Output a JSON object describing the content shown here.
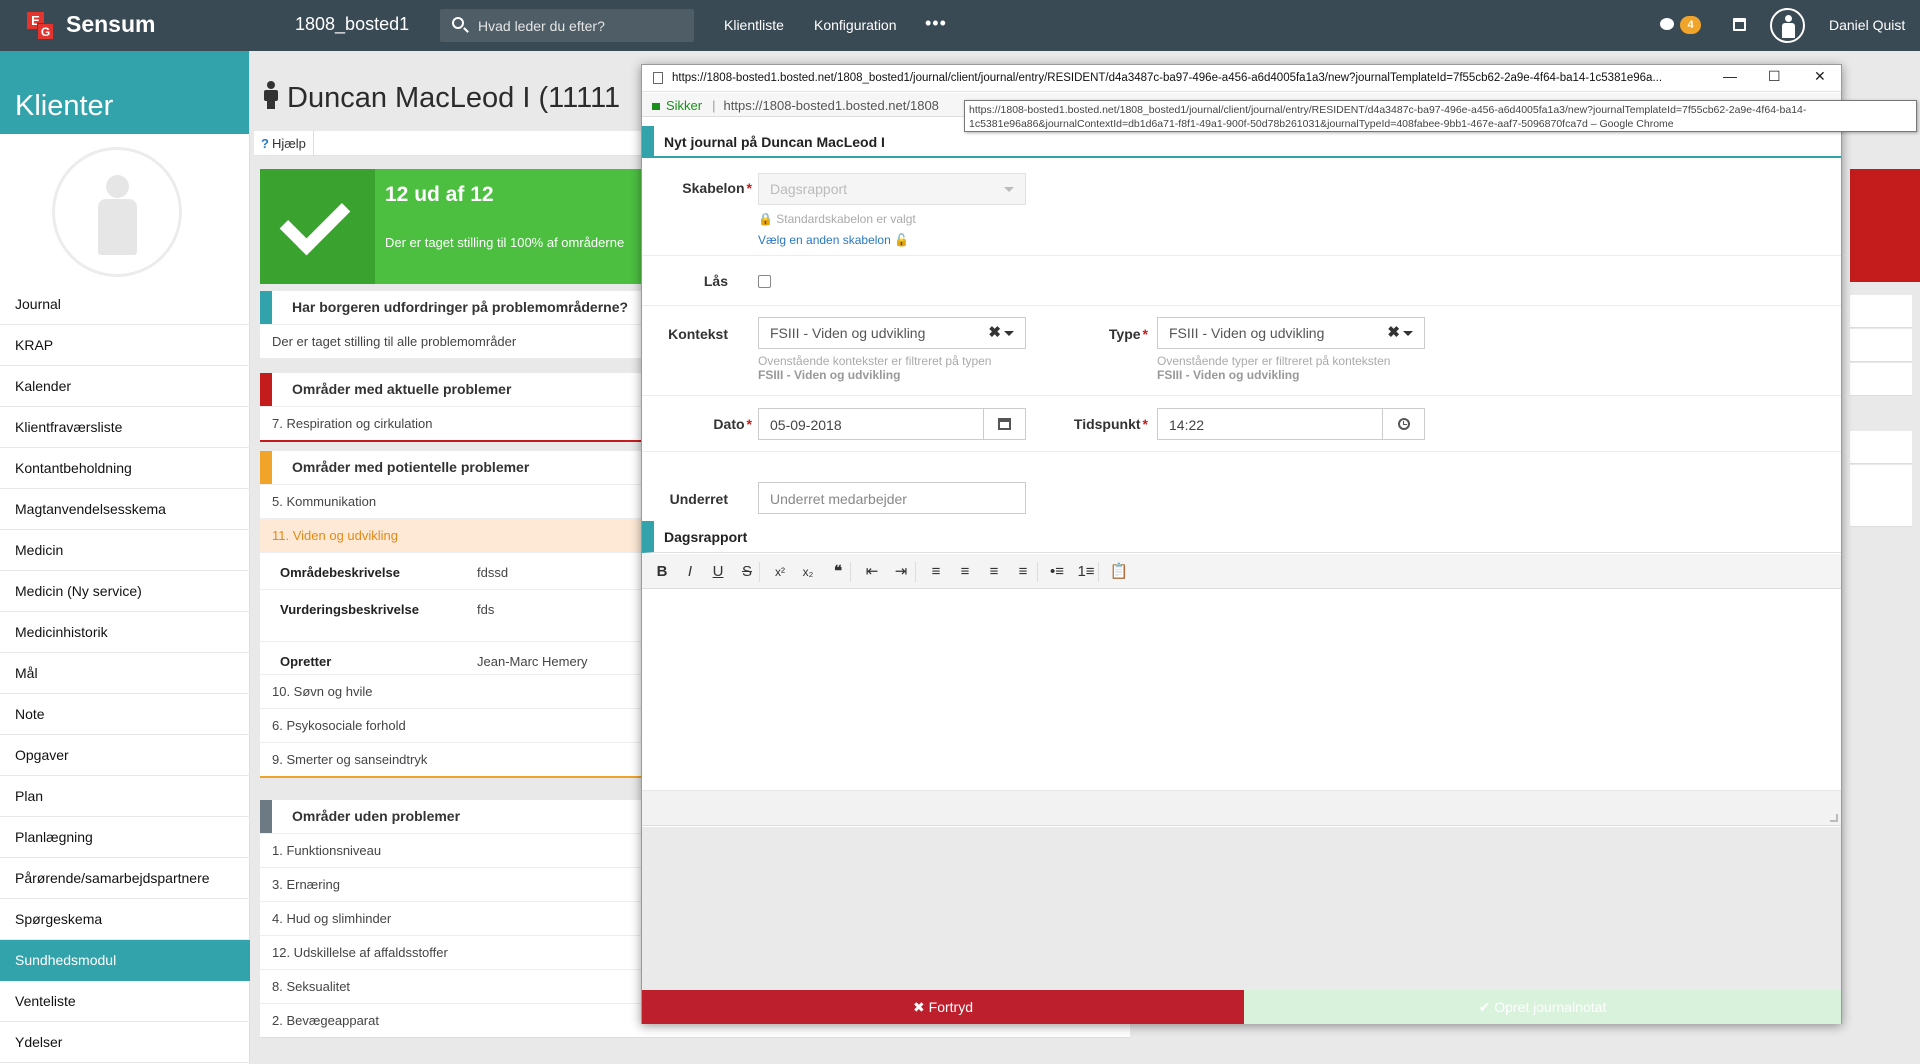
{
  "topbar": {
    "logo_letters": [
      "E",
      "G"
    ],
    "brand": "Sensum",
    "instance": "1808_bosted1",
    "search_placeholder": "Hvad leder du efter?",
    "nav": [
      "Klientliste",
      "Konfiguration"
    ],
    "more": "•••",
    "notifications": "4",
    "user": "Daniel Quist"
  },
  "sidebar": {
    "title": "Klienter",
    "items": [
      "Journal",
      "KRAP",
      "Kalender",
      "Klientfraværsliste",
      "Kontantbeholdning",
      "Magtanvendelsesskema",
      "Medicin",
      "Medicin (Ny service)",
      "Medicinhistorik",
      "Mål",
      "Note",
      "Opgaver",
      "Plan",
      "Planlægning",
      "Pårørende/samarbejdspartnere",
      "Spørgeskema",
      "Sundhedsmodul",
      "Venteliste",
      "Ydelser"
    ],
    "active": "Sundhedsmodul"
  },
  "main": {
    "title": "Duncan MacLeod I (11111",
    "help": "Hjælp",
    "score_title": "12 ud af 12",
    "score_sub": "Der er taget stilling til 100% af områderne",
    "sections": [
      {
        "title": "Har borgeren udfordringer på problemområderne?",
        "color": "#33a3ab",
        "rows": [
          "Der er taget stilling til alle problemområder"
        ]
      },
      {
        "title": "Områder med aktuelle problemer",
        "color": "#c41c1c",
        "rows": [
          "7. Respiration og cirkulation"
        ]
      },
      {
        "title": "Områder med potientelle problemer",
        "color": "#f0a42a",
        "rows": [
          "5. Kommunikation",
          "11. Viden og udvikling"
        ],
        "details": [
          {
            "label": "Områdebeskrivelse",
            "value": "fdssd"
          },
          {
            "label": "Vurderingsbeskrivelse",
            "value": "fds"
          },
          {
            "label": "Opretter",
            "value": "Jean-Marc Hemery"
          }
        ],
        "rows_after": [
          "10. Søvn og hvile",
          "6. Psykosociale forhold",
          "9. Smerter og sanseindtryk"
        ]
      },
      {
        "title": "Områder uden problemer",
        "color": "#6d7a84",
        "rows": [
          "1. Funktionsniveau",
          "3. Ernæring",
          "4. Hud og slimhinder",
          "12. Udskillelse af affaldsstoffer",
          "8. Seksualitet",
          "2. Bevægeapparat"
        ]
      }
    ]
  },
  "dialog": {
    "window_url": "https://1808-bosted1.bosted.net/1808_bosted1/journal/client/journal/entry/RESIDENT/d4a3487c-ba97-496e-a456-a6d4005fa1a3/new?journalTemplateId=7f55cb62-2a9e-4f64-ba14-1c5381e96a...",
    "win_controls": [
      "—",
      "☐",
      "✕"
    ],
    "secure_label": "Sikker",
    "address_url": "https://1808-bosted1.bosted.net/1808",
    "tooltip": "https://1808-bosted1.bosted.net/1808_bosted1/journal/client/journal/entry/RESIDENT/d4a3487c-ba97-496e-a456-a6d4005fa1a3/new?journalTemplateId=7f55cb62-2a9e-4f64-ba14-1c5381e96a86&journalContextId=db1d6a71-f8f1-49a1-900f-50d78b261031&journalTypeId=408fabee-9bb1-467e-aaf7-5096870fca7d – Google Chrome",
    "heading": "Nyt journal på Duncan MacLeod I",
    "template_label": "Skabelon",
    "template_value": "Dagsrapport",
    "template_hint": "Standardskabelon er valgt",
    "template_link": "Vælg en anden skabelon",
    "lock_label": "Lås",
    "context_label": "Kontekst",
    "context_value": "FSIII - Viden og udvikling",
    "context_hint": "Ovenstående kontekster er filtreret på typen",
    "context_hint_bold": "FSIII - Viden og udvikling",
    "type_label": "Type",
    "type_value": "FSIII - Viden og udvikling",
    "type_hint": "Ovenstående typer er filtreret på konteksten",
    "type_hint_bold": "FSIII - Viden og udvikling",
    "date_label": "Dato",
    "date_value": "05-09-2018",
    "time_label": "Tidspunkt",
    "time_value": "14:22",
    "notify_label": "Underret",
    "notify_placeholder": "Underret medarbejder",
    "editor_title": "Dagsrapport",
    "toolbar": [
      "B",
      "I",
      "U",
      "S",
      "x²",
      "x₂",
      "❝",
      "⇤",
      "⇥",
      "≡",
      "≡",
      "≡",
      "≡",
      "•≡",
      "1≡",
      "📋"
    ],
    "cancel": "✖ Fortryd",
    "submit": "✔ Opret journalnotat"
  }
}
